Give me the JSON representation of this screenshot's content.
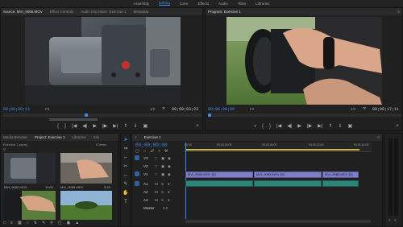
{
  "workspaces": [
    "Assembly",
    "Editing",
    "Color",
    "Effects",
    "Audio",
    "Titles",
    "Libraries"
  ],
  "active_workspace": "Editing",
  "source_panel": {
    "tabs": [
      "Source: MVI_9086.MOV",
      "Effect Controls",
      "Audio Clip Mixer: Exercise 1",
      "Metadata"
    ],
    "timecode_in": "00;00;08;12",
    "fit": "Fit",
    "fraction": "1/2",
    "duration": "00;00;03;23"
  },
  "program_panel": {
    "tabs": [
      "Program: Exercise 1"
    ],
    "timecode": "00;00;00;00",
    "fit": "Fit",
    "fraction": "1/2",
    "duration": "00;00;17;11"
  },
  "project_panel": {
    "tabs": [
      "Media Browser",
      "Project: Exercise 1",
      "Libraries",
      "Info"
    ],
    "project_file": "Exercise 1.prproj",
    "item_count": "6 Items",
    "items": [
      {
        "name": "MVI_9082.MOV",
        "duration": "19:04"
      },
      {
        "name": "MVI_9089.MOV",
        "duration": "3:23"
      },
      {
        "name": "",
        "duration": ""
      },
      {
        "name": "",
        "duration": ""
      }
    ]
  },
  "timeline": {
    "tab": "Exercise 1",
    "timecode": "00;00;00;00",
    "ruler_labels": [
      "00;00",
      "00;00;04;00",
      "00;00;08;00",
      "00;00;12;00",
      "00;00;16;00"
    ],
    "tracks_video": [
      "V3",
      "V2",
      "V1"
    ],
    "tracks_audio": [
      "A1",
      "A2",
      "A3"
    ],
    "master_label": "Master",
    "master_value": "0.0",
    "clips": [
      "MVI_9084.MOV [V]",
      "MVI_9083.MOV [V]",
      "MVI_9083.MOV [V]"
    ]
  },
  "tools": [
    "selection",
    "track-select",
    "ripple",
    "razor",
    "slip",
    "pen",
    "hand",
    "type"
  ]
}
